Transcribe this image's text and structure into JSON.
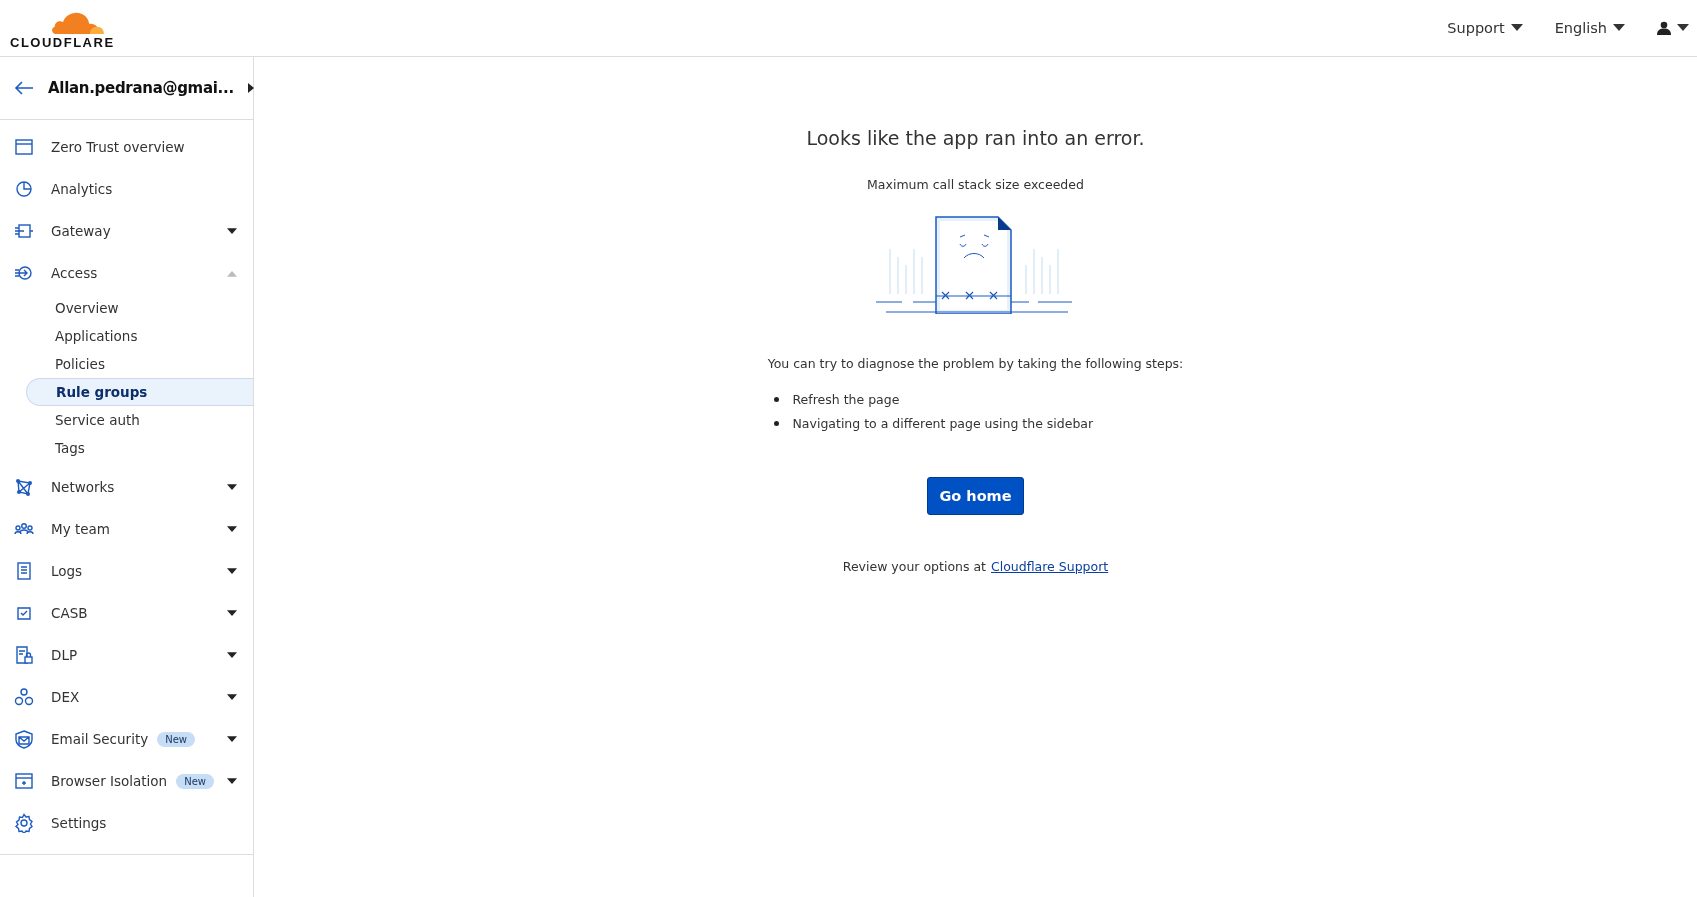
{
  "header": {
    "logo": "CLOUDFLARE",
    "menus": [
      {
        "kind": "text",
        "label": "Support"
      },
      {
        "kind": "text",
        "label": "English"
      },
      {
        "kind": "user"
      }
    ]
  },
  "sidebar": {
    "account": "Allan.pedrana@gmai...",
    "items": [
      {
        "label": "Zero Trust overview"
      },
      {
        "label": "Analytics"
      },
      {
        "label": "Gateway",
        "expanded": false
      },
      {
        "label": "Access",
        "expanded": true,
        "children": [
          {
            "label": "Overview",
            "selected": false
          },
          {
            "label": "Applications",
            "selected": false
          },
          {
            "label": "Policies",
            "selected": false
          },
          {
            "label": "Rule groups",
            "selected": true
          },
          {
            "label": "Service auth",
            "selected": false
          },
          {
            "label": "Tags",
            "selected": false
          }
        ]
      },
      {
        "label": "Networks",
        "expanded": false
      },
      {
        "label": "My team",
        "expanded": false
      },
      {
        "label": "Logs",
        "expanded": false
      },
      {
        "label": "CASB",
        "expanded": false
      },
      {
        "label": "DLP",
        "expanded": false
      },
      {
        "label": "DEX",
        "expanded": false
      },
      {
        "label": "Email Security",
        "badge": "New",
        "expanded": false
      },
      {
        "label": "Browser Isolation",
        "badge": "New",
        "expanded": false
      },
      {
        "label": "Settings"
      }
    ]
  },
  "error": {
    "title": "Looks like the app ran into an error.",
    "message": "Maximum call stack size exceeded",
    "intro": "You can try to diagnose the problem by taking the following steps:",
    "steps": [
      "Refresh the page",
      "Navigating to a different page using the sidebar"
    ],
    "button": "Go home",
    "footer": "Review your options at",
    "footer_link": "Cloudflare Support"
  }
}
